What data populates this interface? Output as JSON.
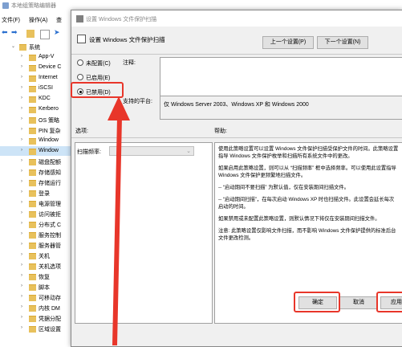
{
  "background": {
    "title": "本地组策略编辑器",
    "menu": [
      "文件(F)",
      "操作(A)",
      "查"
    ],
    "tree_items": [
      {
        "label": "系统",
        "expanded": true,
        "indent": 0
      },
      {
        "label": "App-V",
        "indent": 1
      },
      {
        "label": "Device C",
        "indent": 1
      },
      {
        "label": "Internet",
        "indent": 1
      },
      {
        "label": "iSCSI",
        "indent": 1
      },
      {
        "label": "KDC",
        "indent": 1
      },
      {
        "label": "Kerbero",
        "indent": 1
      },
      {
        "label": "OS 策略",
        "indent": 1
      },
      {
        "label": "PIN 复杂",
        "indent": 1
      },
      {
        "label": "Window",
        "indent": 1
      },
      {
        "label": "Window",
        "indent": 1,
        "selected": true
      },
      {
        "label": "磁盘配额",
        "indent": 1
      },
      {
        "label": "存储感知",
        "indent": 1
      },
      {
        "label": "存储运行",
        "indent": 1
      },
      {
        "label": "登录",
        "indent": 1
      },
      {
        "label": "电源管理",
        "indent": 1
      },
      {
        "label": "访问被拒",
        "indent": 1
      },
      {
        "label": "分布式 C",
        "indent": 1
      },
      {
        "label": "服务控制",
        "indent": 1
      },
      {
        "label": "服务器管",
        "indent": 1
      },
      {
        "label": "关机",
        "indent": 1
      },
      {
        "label": "关机选项",
        "indent": 1
      },
      {
        "label": "恢复",
        "indent": 1
      },
      {
        "label": "脚本",
        "indent": 1
      },
      {
        "label": "可移动存",
        "indent": 1
      },
      {
        "label": "内核 DM",
        "indent": 1
      },
      {
        "label": "凭据分配",
        "indent": 1
      },
      {
        "label": "区域设置",
        "indent": 1
      }
    ]
  },
  "dialog": {
    "title": "设置 Windows 文件保护扫描",
    "heading": "设置 Windows 文件保护扫描",
    "prev_button": "上一个设置(P)",
    "next_button": "下一个设置(N)",
    "options": [
      {
        "label": "未配置(C)",
        "selected": false
      },
      {
        "label": "已启用(E)",
        "selected": false
      },
      {
        "label": "已禁用(D)",
        "selected": true
      }
    ],
    "comment_label": "注释:",
    "supported_label": "支持的平台:",
    "supported_value": "仅 Windows Server 2003、Windows XP 和 Windows 2000",
    "options_label": "选项:",
    "help_label": "帮助:",
    "scan_label": "扫描频率:",
    "scan_value": "",
    "help_paragraphs": [
      "使用此策略设置可以设置 Windows 文件保护扫描受保护文件的时间。此策略设置指导 Windows 文件保护枚举和扫描所有系统文件中的更改。",
      "如果启用此策略设置，则可以从 “扫描频率” 框中选择频率。可以使用此设置指导 Windows 文件保护更频繁地扫描文件。",
      "-- “启动期间不要扫描” 为默认值，仅在安装期间扫描文件。",
      "-- “启动期间扫描”，在每次启动 Windows XP 时也扫描文件。此设置会延长每次启动的时间。",
      "如果禁用或未配置此策略设置，则默认情况下将仅在安装期间扫描文件。",
      "注意: 此策略设置仅影响文件扫描，而不影响 Windows 文件保护提供的标准后台文件更改检测。"
    ],
    "ok_button": "确定",
    "cancel_button": "取消",
    "apply_button": "应用"
  },
  "colors": {
    "annotation": "#e8362a",
    "selection": "#cde4f7",
    "folder": "#e8c15c"
  }
}
